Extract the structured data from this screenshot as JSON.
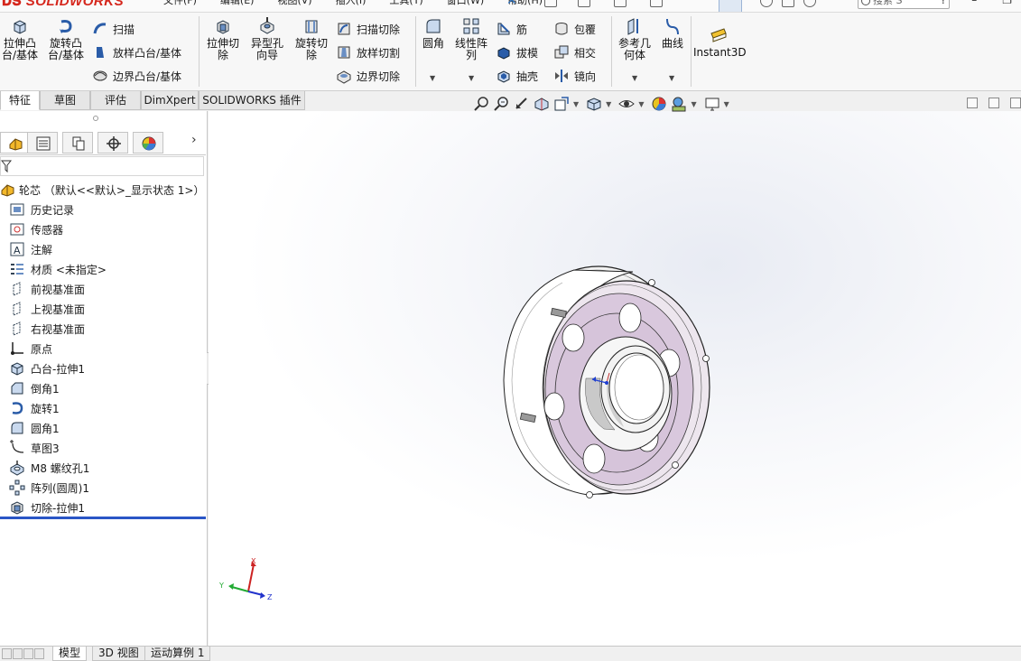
{
  "app": {
    "logo_text": "SOLIDWORKS"
  },
  "menu": {
    "items": [
      "文件(F)",
      "编辑(E)",
      "视图(V)",
      "插入(I)",
      "工具(T)",
      "窗口(W)",
      "帮助(H)"
    ]
  },
  "search": {
    "placeholder": "搜索 S"
  },
  "commands": {
    "extrude_boss": "拉伸凸\n台/基体",
    "revolve_boss": "旋转凸\n台/基体",
    "sweep": "扫描",
    "loft_boss": "放样凸台/基体",
    "boundary_boss": "边界凸台/基体",
    "extrude_cut": "拉伸切\n除",
    "hole_wizard": "异型孔\n向导",
    "revolve_cut": "旋转切\n除",
    "swept_cut": "扫描切除",
    "lofted_cut": "放样切割",
    "boundary_cut": "边界切除",
    "fillet": "圆角",
    "linear_pattern": "线性阵\n列",
    "rib": "筋",
    "draft": "拔模",
    "shell": "抽壳",
    "wrap": "包覆",
    "intersect": "相交",
    "mirror": "镜向",
    "reference_geometry": "参考几\n何体",
    "curves": "曲线",
    "instant3d": "Instant3D"
  },
  "cm_tabs": [
    "特征",
    "草图",
    "评估",
    "DimXpert",
    "SOLIDWORKS 插件"
  ],
  "feature_tree": {
    "root": "轮芯 （默认<<默认>_显示状态 1>）",
    "items": [
      {
        "label": "历史记录",
        "icon": "history-icon"
      },
      {
        "label": "传感器",
        "icon": "sensor-icon"
      },
      {
        "label": "注解",
        "icon": "annotation-icon"
      },
      {
        "label": "材质 <未指定>",
        "icon": "material-icon"
      },
      {
        "label": "前视基准面",
        "icon": "plane-icon"
      },
      {
        "label": "上视基准面",
        "icon": "plane-icon"
      },
      {
        "label": "右视基准面",
        "icon": "plane-icon"
      },
      {
        "label": "原点",
        "icon": "origin-icon"
      },
      {
        "label": "凸台-拉伸1",
        "icon": "boss-extrude-icon"
      },
      {
        "label": "倒角1",
        "icon": "chamfer-icon"
      },
      {
        "label": "旋转1",
        "icon": "revolve-icon"
      },
      {
        "label": "圆角1",
        "icon": "fillet-icon"
      },
      {
        "label": "草图3",
        "icon": "sketch-icon"
      },
      {
        "label": "M8 螺纹孔1",
        "icon": "hole-icon"
      },
      {
        "label": "阵列(圆周)1",
        "icon": "circular-pattern-icon"
      },
      {
        "label": "切除-拉伸1",
        "icon": "cut-extrude-icon"
      }
    ]
  },
  "triad": {
    "x": "X",
    "y": "Y",
    "z": "Z"
  },
  "bottom_tabs": [
    "模型",
    "3D 视图",
    "运动算例 1"
  ]
}
